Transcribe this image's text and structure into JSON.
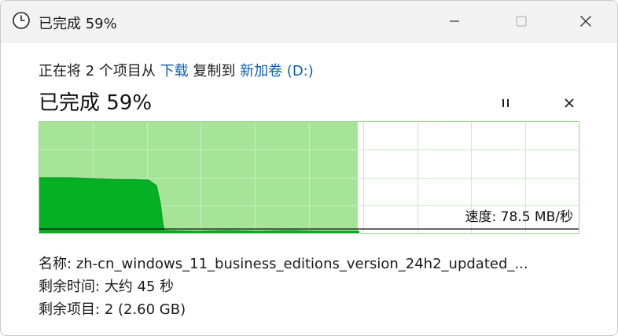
{
  "window": {
    "title": "已完成 59%"
  },
  "header": {
    "prefix": "正在将 2 个项目从 ",
    "source_link": "下载",
    "middle": " 复制到 ",
    "dest_link": "新加卷 (D:)"
  },
  "progress": {
    "label": "已完成 59%",
    "fraction": 0.59,
    "speed_text": "速度: 78.5 MB/秒"
  },
  "details": {
    "name_label": "名称:",
    "name_value": "zh-cn_windows_11_business_editions_version_24h2_updated_...",
    "time_label": "剩余时间:",
    "time_value": "大约 45 秒",
    "items_label": "剩余项目:",
    "items_value": "2 (2.60 GB)"
  },
  "colors": {
    "progress_fill": "#a6e497",
    "speed_fill": "#06b025",
    "grid": "#c8ecc2",
    "link": "#0f5fb0"
  },
  "icons": [
    "clock-icon",
    "minimize-icon",
    "maximize-icon",
    "close-icon",
    "pause-icon",
    "cancel-icon"
  ]
}
